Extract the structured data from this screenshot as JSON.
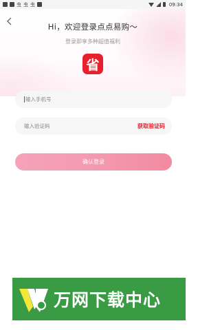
{
  "status_bar": {
    "left_glyphs": [
      "虫",
      "虫",
      "虫"
    ],
    "time": "09:34"
  },
  "header": {
    "greeting": "Hi，欢迎登录点点易购～",
    "subtitle": "登录即享多种超值福利",
    "logo_char": "省"
  },
  "form": {
    "phone_placeholder": "输入手机号",
    "code_placeholder": "输入验证码",
    "get_code_label": "获取验证码",
    "login_label": "确认登录"
  },
  "watermark": {
    "text": "万网下载中心"
  },
  "colors": {
    "accent": "#e8202e",
    "button_gradient_start": "#f5a2ba",
    "button_gradient_end": "#f28aa1",
    "watermark_bg": "#3a9b45"
  },
  "icons": {
    "back": "back-arrow-icon",
    "wifi": "wifi-icon",
    "signal": "signal-icon",
    "battery": "battery-icon"
  }
}
